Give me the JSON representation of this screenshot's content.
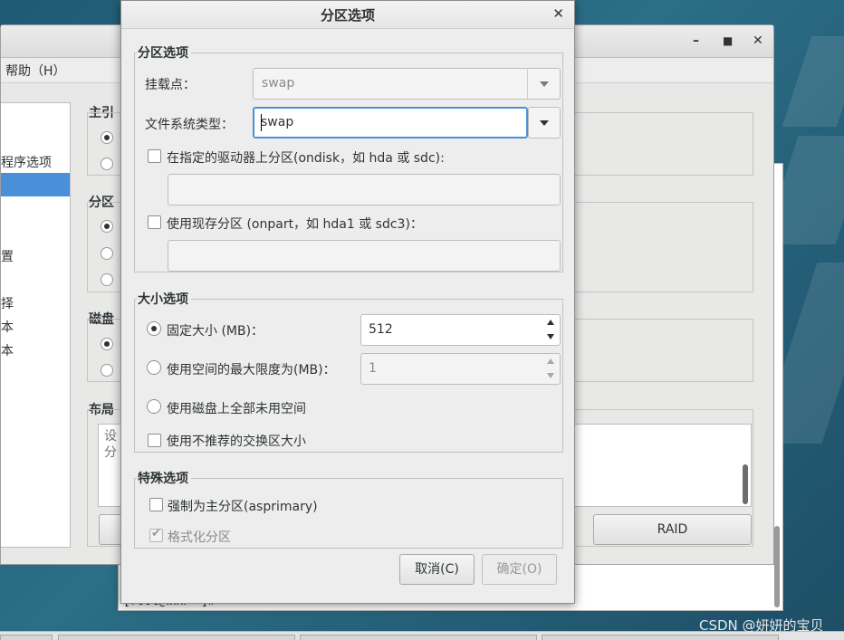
{
  "desktop": {
    "watermark": "CSDN @妍妍的宝贝"
  },
  "terminal": {
    "prompt": "[root@www ~]# "
  },
  "main_window": {
    "menu_help": "帮助（H）",
    "left_items": [
      "程序选项",
      "置",
      "择",
      "本",
      "本"
    ],
    "group_labels": [
      "主引",
      "分区",
      "磁盘",
      "布局"
    ],
    "list_text": [
      "设",
      "分"
    ],
    "raid_button": "RAID"
  },
  "dialog": {
    "title": "分区选项",
    "partition_options": {
      "section_title": "分区选项",
      "mount_point_label": "挂载点：",
      "mount_point_value": "swap",
      "fs_type_label": "文件系统类型：",
      "fs_type_value": "swap",
      "ondisk_label": "在指定的驱动器上分区(ondisk，如 hda 或 sdc):",
      "ondisk_value": "",
      "onpart_label": "使用现存分区 (onpart，如 hda1 或 sdc3)：",
      "onpart_value": ""
    },
    "size_options": {
      "section_title": "大小选项",
      "fixed_size_label": "固定大小 (MB)：",
      "fixed_size_value": "512",
      "max_size_label": "使用空间的最大限度为(MB)：",
      "max_size_value": "1",
      "fill_disk_label": "使用磁盘上全部未用空间",
      "recommended_swap_label": "使用不推荐的交换区大小"
    },
    "special_options": {
      "section_title": "特殊选项",
      "asprimary_label": "强制为主分区(asprimary)",
      "format_label": "格式化分区"
    },
    "buttons": {
      "cancel": "取消(C)",
      "ok": "确定(O)"
    }
  }
}
